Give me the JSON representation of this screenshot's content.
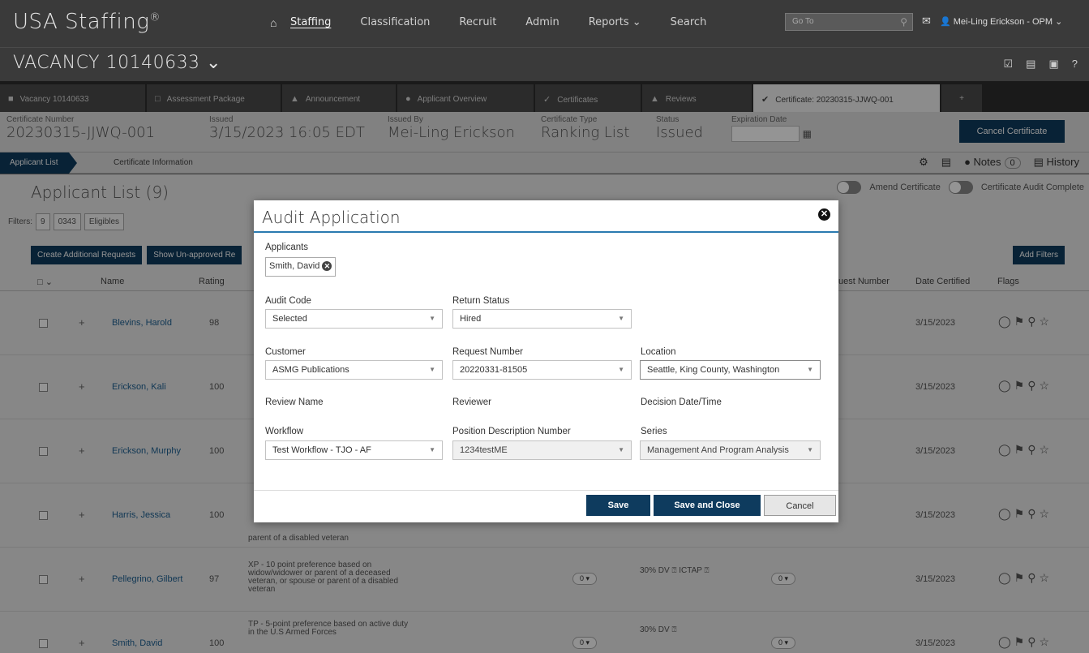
{
  "app": {
    "brand": "USA Staffing",
    "brand_mark": "®"
  },
  "nav": {
    "items": [
      "Staffing",
      "Classification",
      "Recruit",
      "Admin",
      "Reports ⌄",
      "Search"
    ],
    "active": "Staffing",
    "goto_placeholder": "Go To",
    "user": "Mei-Ling Erickson - OPM ⌄"
  },
  "vacancy": {
    "title": "VACANCY 10140633 ⌄"
  },
  "tabs": [
    {
      "label": "Vacancy 10140633",
      "icon": "folder-icon"
    },
    {
      "label": "Assessment Package",
      "icon": "files-icon"
    },
    {
      "label": "Announcement",
      "icon": "megaphone-icon"
    },
    {
      "label": "Applicant Overview",
      "icon": "users-icon"
    },
    {
      "label": "Certificates",
      "icon": "check-circle-icon"
    },
    {
      "label": "Reviews",
      "icon": "thumbs-up-icon"
    },
    {
      "label": "Certificate: 20230315-JJWQ-001",
      "icon": "check-circle-icon",
      "active": true
    },
    {
      "label": "+",
      "icon": "plus-icon"
    }
  ],
  "certificate": {
    "number_label": "Certificate Number",
    "number": "20230315-JJWQ-001",
    "issued_label": "Issued",
    "issued": "3/15/2023 16:05 EDT",
    "issued_by_label": "Issued By",
    "issued_by": "Mei-Ling Erickson",
    "type_label": "Certificate Type",
    "type": "Ranking List",
    "status_label": "Status",
    "status": "Issued",
    "expiration_label": "Expiration Date",
    "cancel_label": "Cancel Certificate"
  },
  "subnav": {
    "crumb1": "Applicant List",
    "crumb2": "Certificate Information",
    "notes_label": "Notes",
    "notes_count": "0",
    "history_label": "History"
  },
  "applicant_list": {
    "title": "Applicant List (9)",
    "amend_label": "Amend Certificate",
    "audit_complete_label": "Certificate Audit Complete",
    "filters_label": "Filters:",
    "filters": [
      "9",
      "0343",
      "Eligibles"
    ],
    "btn_create": "Create Additional Requests",
    "btn_unapproved": "Show Un-approved Re",
    "btn_add_filters": "Add Filters",
    "columns": {
      "name": "Name",
      "rating": "Rating",
      "request": "uest Number",
      "date": "Date Certified",
      "flags": "Flags"
    },
    "rows": [
      {
        "name": "Blevins, Harold",
        "rating": "98",
        "pref": "",
        "dv": "",
        "date": "3/15/2023"
      },
      {
        "name": "Erickson, Kali",
        "rating": "100",
        "pref": "",
        "dv": "",
        "date": "3/15/2023"
      },
      {
        "name": "Erickson, Murphy",
        "rating": "100",
        "pref": "",
        "dv": "",
        "date": "3/15/2023"
      },
      {
        "name": "Harris, Jessica",
        "rating": "100",
        "pref": "parent of a disabled veteran",
        "dv": "",
        "date": "3/15/2023"
      },
      {
        "name": "Pellegrino, Gilbert",
        "rating": "97",
        "pref": "XP - 10 point preference based on widow/widower or parent of a deceased veteran, or spouse or parent of a disabled veteran",
        "dv": "30% DV ⍰   ICTAP ⍰",
        "date": "3/15/2023",
        "pills": true
      },
      {
        "name": "Smith, David",
        "rating": "100",
        "pref": "TP - 5-point preference based on active duty in the U.S Armed Forces",
        "dv": "30% DV ⍰",
        "date": "3/15/2023",
        "pills": true
      }
    ],
    "pill_label": "0 ▾"
  },
  "modal": {
    "title": "Audit Application",
    "applicants_label": "Applicants",
    "applicant_chip": "Smith, David",
    "audit_code_label": "Audit Code",
    "audit_code": "Selected",
    "return_status_label": "Return Status",
    "return_status": "Hired",
    "customer_label": "Customer",
    "customer": "ASMG Publications",
    "request_number_label": "Request Number",
    "request_number": "20220331-81505",
    "location_label": "Location",
    "location": "Seattle, King County, Washington",
    "review_name_label": "Review Name",
    "reviewer_label": "Reviewer",
    "decision_label": "Decision Date/Time",
    "workflow_label": "Workflow",
    "workflow": "Test Workflow - TJO - AF",
    "pd_number_label": "Position Description Number",
    "pd_number": "1234testME",
    "series_label": "Series",
    "series": "Management And Program Analysis",
    "save": "Save",
    "save_close": "Save and Close",
    "cancel": "Cancel"
  }
}
